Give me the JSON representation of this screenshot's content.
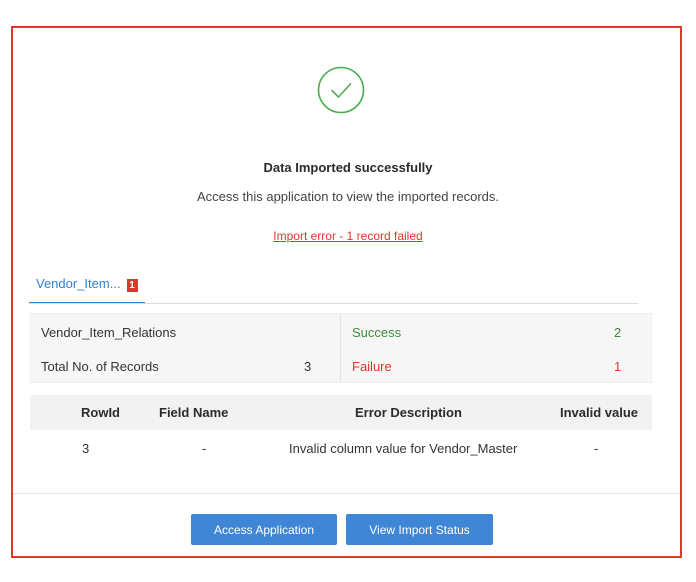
{
  "dialog": {
    "title": "Data Imported successfully",
    "subtitle": "Access this application to view the imported records.",
    "error_link": "Import error - 1 record failed"
  },
  "tab": {
    "label": "Vendor_Item...",
    "badge": "1"
  },
  "summary": {
    "relation_name": "Vendor_Item_Relations",
    "total_label": "Total No. of Records",
    "total_value": "3",
    "success_label": "Success",
    "success_value": "2",
    "failure_label": "Failure",
    "failure_value": "1"
  },
  "error_table": {
    "columns": [
      "RowId",
      "Field Name",
      "Error Description",
      "Invalid value"
    ],
    "rows": [
      [
        "3",
        "-",
        "Invalid column value for Vendor_Master",
        "-"
      ]
    ]
  },
  "buttons": {
    "access": "Access Application",
    "view_status": "View Import Status"
  },
  "colors": {
    "accent": "#3f86d6",
    "success": "#3a8d3a",
    "error": "#e0372b"
  },
  "icons": {
    "success": "check-circle-icon"
  }
}
